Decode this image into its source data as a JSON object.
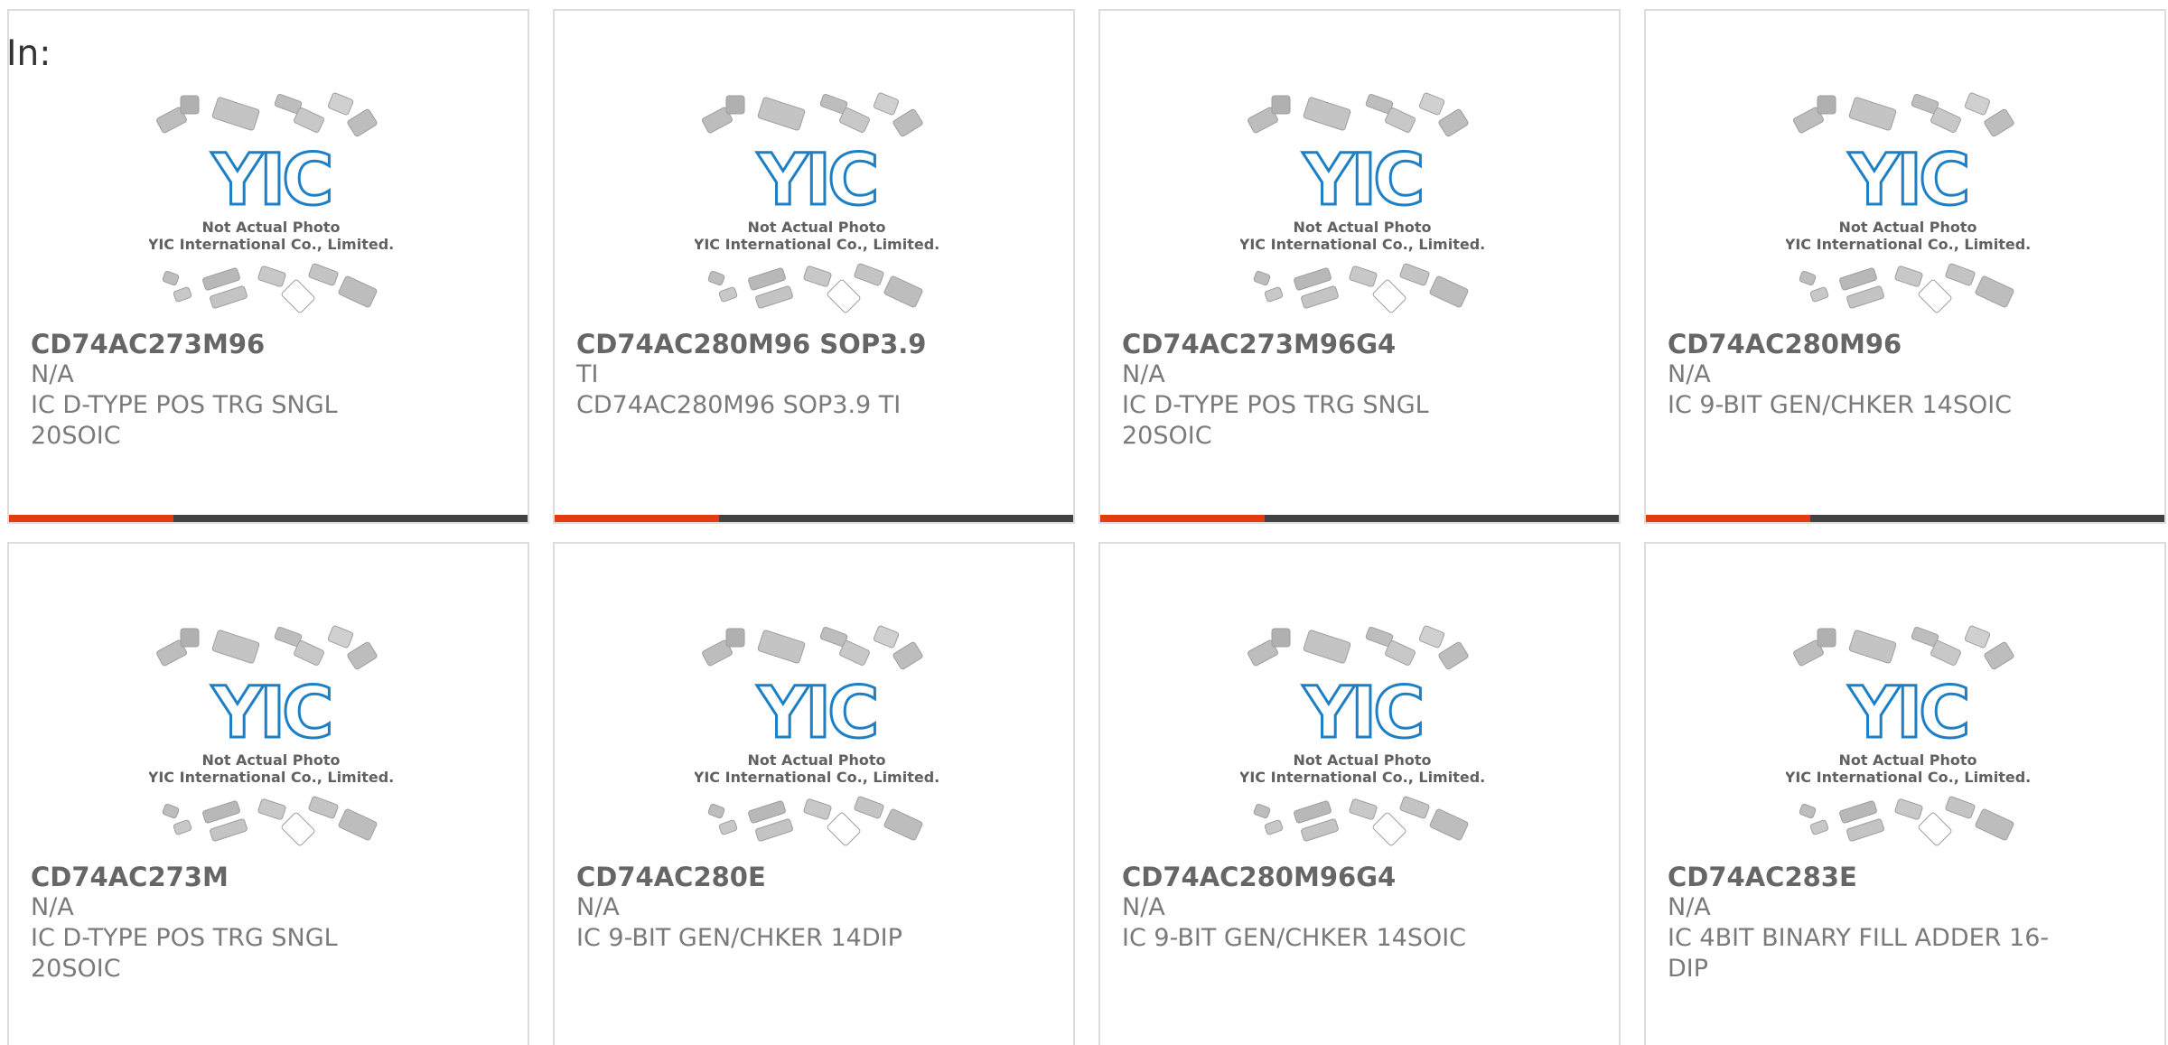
{
  "prefix_label": "In:",
  "colors": {
    "accent": "#e63a10",
    "bar": "#424242",
    "logo_blue": "#1d7fc6",
    "chip_gray": "#bdbdbd"
  },
  "placeholder_image": {
    "logo_text": "YIC",
    "line1": "Not Actual Photo",
    "line2": "YIC International Co., Limited."
  },
  "products": [
    {
      "name": "CD74AC273M96",
      "manufacturer": "N/A",
      "description": "IC D-TYPE POS TRG SNGL 20SOIC"
    },
    {
      "name": "CD74AC280M96 SOP3.9",
      "manufacturer": "TI",
      "description": "CD74AC280M96 SOP3.9 TI"
    },
    {
      "name": "CD74AC273M96G4",
      "manufacturer": "N/A",
      "description": "IC D-TYPE POS TRG SNGL 20SOIC"
    },
    {
      "name": "CD74AC280M96",
      "manufacturer": "N/A",
      "description": "IC 9-BIT GEN/CHKER 14SOIC"
    },
    {
      "name": "CD74AC273M",
      "manufacturer": "N/A",
      "description": "IC D-TYPE POS TRG SNGL 20SOIC"
    },
    {
      "name": "CD74AC280E",
      "manufacturer": "N/A",
      "description": "IC 9-BIT GEN/CHKER 14DIP"
    },
    {
      "name": "CD74AC280M96G4",
      "manufacturer": "N/A",
      "description": "IC 9-BIT GEN/CHKER 14SOIC"
    },
    {
      "name": "CD74AC283E",
      "manufacturer": "N/A",
      "description": "IC 4BIT BINARY FILL ADDER 16-DIP"
    }
  ]
}
